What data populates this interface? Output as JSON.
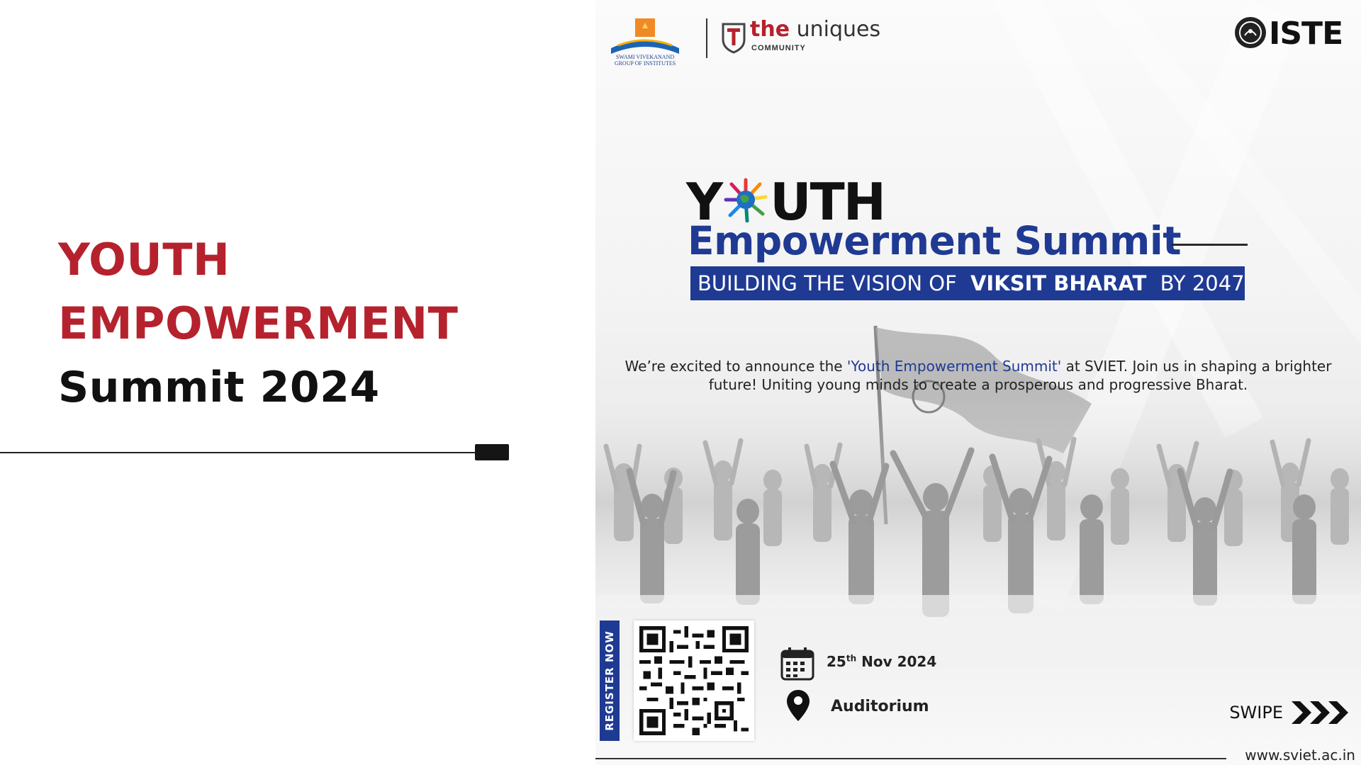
{
  "left_panel": {
    "title_line1": "YOUTH",
    "title_line2": "EMPOWERMENT",
    "title_line3": "Summit 2024",
    "accent_color": "#b5222d"
  },
  "poster": {
    "logos": {
      "svgi_line1": "SWAMI VIVEKANAND",
      "svgi_line2": "GROUP OF INSTITUTES",
      "uniques_the": "the",
      "uniques_name": "uniques",
      "uniques_sub": "COMMUNITY",
      "iste": "ISTE"
    },
    "headline_youth_y": "Y",
    "headline_youth_rest": "UTH",
    "headline_emp": "Empowerment Summit",
    "banner_part1": "BUILDING THE VISION OF",
    "banner_bold": "VIKSIT BHARAT",
    "banner_part2": "BY 2047",
    "blurb_pre": "We’re excited to announce the ",
    "blurb_highlight": "'Youth Empowerment Summit'",
    "blurb_post": " at SVIET. Join us in shaping a brighter future! Uniting young minds to create a prosperous and progressive Bharat.",
    "register_label": "REGISTER NOW",
    "date_day": "25",
    "date_suffix": "th",
    "date_rest": " Nov 2024",
    "venue": "Auditorium",
    "swipe_label": "SWIPE",
    "website": "www.sviet.ac.in",
    "brand_blue": "#1f3a93"
  }
}
